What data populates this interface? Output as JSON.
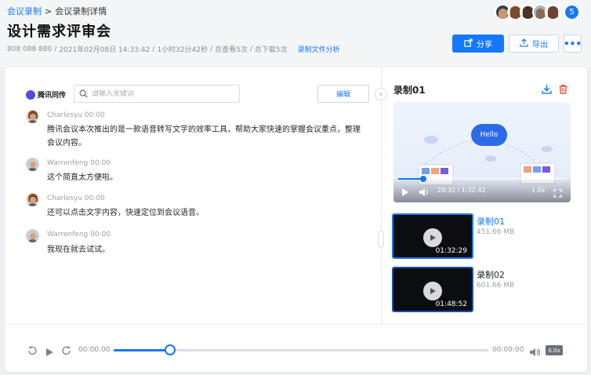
{
  "breadcrumb": {
    "parent": "会议录制",
    "separator": ">",
    "current": "会议录制详情"
  },
  "page": {
    "title": "设计需求评审会",
    "meeting_id": "808 088 880",
    "datetime": "2021年02月08日 14:33:42",
    "duration": "1小时32分42秒",
    "views": "总查看5次",
    "downloads": "总下载5次",
    "analysis_link": "录制文件分析",
    "meta_separator": "/"
  },
  "participants": {
    "count": "5"
  },
  "toolbar": {
    "share_label": "分享",
    "export_label": "导出",
    "more_label": "•••"
  },
  "transcript": {
    "logo_text": "腾讯同传",
    "search_placeholder": "请输入关键词",
    "search_value": "",
    "edit_label": "编辑",
    "messages": [
      {
        "speaker": "Charlesyu",
        "time": "00:00",
        "text": "腾讯会议本次推出的是一款语音转写文字的效率工具，帮助大家快速的掌握会议重点，整理会议内容。"
      },
      {
        "speaker": "Warrenfeng",
        "time": "00:00",
        "text": "这个简直太方便啦。"
      },
      {
        "speaker": "Charlesyu",
        "time": "00:00",
        "text": "还可以点击文字内容，快速定位到会议语音。"
      },
      {
        "speaker": "Warrenfeng",
        "time": "00:00",
        "text": "我现在就去试试。"
      }
    ]
  },
  "recordings": {
    "panel_title": "录制01",
    "player": {
      "cloud_text": "Hello",
      "current_time": "28:32",
      "time_separator": "/",
      "total_time": "1:32:42",
      "speed": "1.0x",
      "progress": 0.15
    },
    "items": [
      {
        "name": "录制01",
        "size": "451.66 MB",
        "duration": "01:32:29",
        "active": true
      },
      {
        "name": "录制02",
        "size": "601.66 MB",
        "duration": "01:48:52",
        "active": false
      }
    ]
  },
  "audio_player": {
    "current_time": "00:00:00",
    "total_time": "00:00:00",
    "speed": "0.0x",
    "progress": 0.15
  },
  "colors": {
    "accent": "#1677ff",
    "delete": "#e5483f"
  },
  "icons": [
    "share-icon",
    "export-icon",
    "search-icon",
    "download-icon",
    "delete-icon",
    "play-icon",
    "volume-icon",
    "fullscreen-icon",
    "rewind-icon",
    "forward-icon"
  ]
}
